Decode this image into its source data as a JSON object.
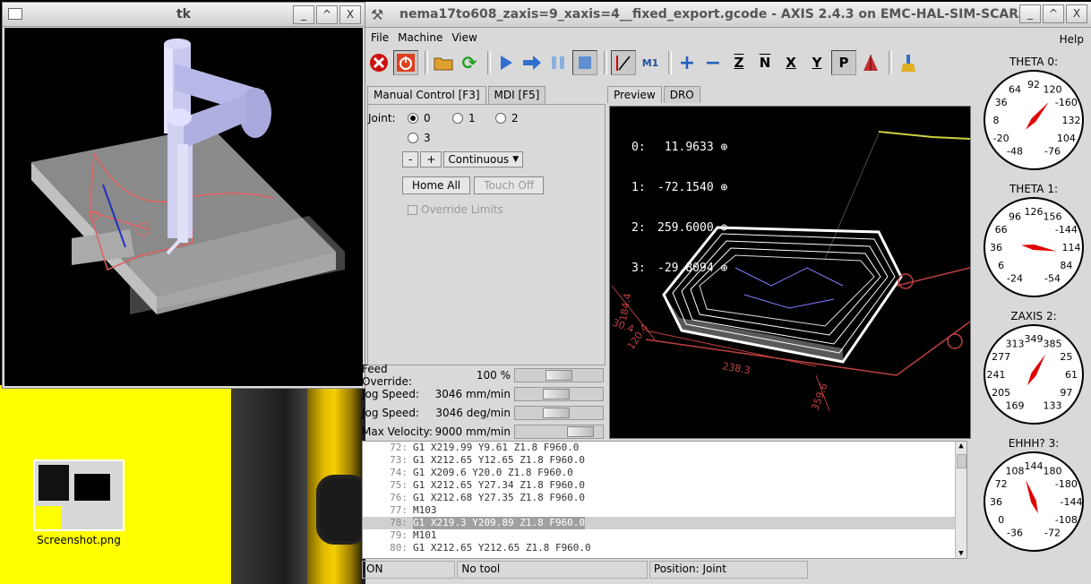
{
  "desktop": {
    "icon_label": "Screenshot.png"
  },
  "tk_window": {
    "title": "tk",
    "min": "_",
    "max": "^",
    "close": "X"
  },
  "axis_window": {
    "title": "nema17to608_zaxis=9_xaxis=4__fixed_export.gcode - AXIS 2.4.3 on EMC-HAL-SIM-SCARA",
    "menu": [
      "File",
      "Machine",
      "View"
    ],
    "help": "Help",
    "left_tabs": [
      "Manual Control [F3]",
      "MDI [F5]"
    ],
    "right_tabs": [
      "Preview",
      "DRO"
    ],
    "manual": {
      "joint_label": "Joint:",
      "joints": [
        "0",
        "1",
        "2",
        "3"
      ],
      "selected_joint": "0",
      "minus": "-",
      "plus": "+",
      "jog_mode": "Continuous",
      "home_all": "Home All",
      "touch_off": "Touch Off",
      "override_limits": "Override Limits"
    },
    "sliders": [
      {
        "label": "Feed Override:",
        "value": "100 %",
        "fraction": 0.5
      },
      {
        "label": "Jog Speed:",
        "value": "3046 mm/min",
        "fraction": 0.45
      },
      {
        "label": "Jog Speed:",
        "value": "3046 deg/min",
        "fraction": 0.45
      },
      {
        "label": "Max Velocity:",
        "value": "9000 mm/min",
        "fraction": 0.85
      }
    ],
    "dro": [
      {
        "axis": "0:",
        "value": "11.9633"
      },
      {
        "axis": "1:",
        "value": "-72.1540"
      },
      {
        "axis": "2:",
        "value": "259.6000"
      },
      {
        "axis": "3:",
        "value": "-29.8094"
      }
    ],
    "preview_dims": [
      "238.3",
      "359.6",
      "120.4",
      "30.4",
      "184.4"
    ],
    "gcode": [
      {
        "n": "72:",
        "code": "G1 X219.99 Y9.61 Z1.8 F960.0"
      },
      {
        "n": "73:",
        "code": "G1 X212.65 Y12.65 Z1.8 F960.0"
      },
      {
        "n": "74:",
        "code": "G1 X209.6 Y20.0 Z1.8 F960.0"
      },
      {
        "n": "75:",
        "code": "G1 X212.65 Y27.34 Z1.8 F960.0"
      },
      {
        "n": "76:",
        "code": "G1 X212.68 Y27.35 Z1.8 F960.0"
      },
      {
        "n": "77:",
        "code": "M103"
      },
      {
        "n": "78:",
        "code": "G1 X219.3 Y209.89 Z1.8 F960.0"
      },
      {
        "n": "79:",
        "code": "M101"
      },
      {
        "n": "80:",
        "code": "G1 X212.65 Y212.65 Z1.8 F960.0"
      }
    ],
    "highlighted_line": "78:",
    "status": [
      "ON",
      "No tool",
      "Position: Joint"
    ],
    "gauges": [
      {
        "label": "THETA 0:",
        "ticks": [
          "-48",
          "-20",
          "8",
          "36",
          "64",
          "92",
          "120",
          "-160",
          "132",
          "104",
          "-76"
        ],
        "needle_deg": 40
      },
      {
        "label": "THETA 1:",
        "ticks": [
          "-24",
          "6",
          "36",
          "66",
          "96",
          "126",
          "156",
          "-144",
          "114",
          "84",
          "-54"
        ],
        "needle_deg": 100
      },
      {
        "label": "ZAXIS 2:",
        "ticks": [
          "169",
          "205",
          "241",
          "277",
          "313",
          "349",
          "385",
          "25",
          "61",
          "97",
          "133"
        ],
        "needle_deg": 30
      },
      {
        "label": "EHHH? 3:",
        "ticks": [
          "-36",
          "0",
          "36",
          "72",
          "108",
          "144",
          "180",
          "-180",
          "-144",
          "-108",
          "-72"
        ],
        "needle_deg": -20
      }
    ],
    "colors": {
      "stop_red": "#cc1010",
      "plus_blue": "#2060c0",
      "needle": "#e00000",
      "toolpath_red": "#c04040"
    }
  }
}
